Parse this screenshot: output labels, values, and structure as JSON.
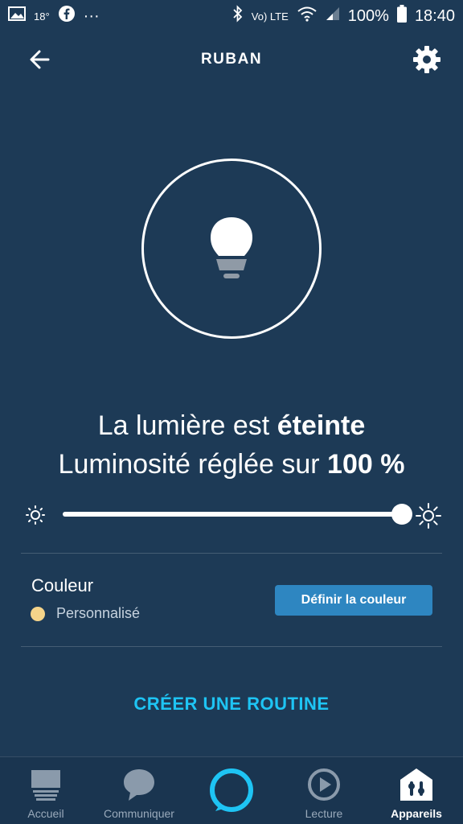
{
  "status_bar": {
    "temperature": "18°",
    "more": "···",
    "network": "Vo) LTE",
    "battery": "100%",
    "time": "18:40"
  },
  "header": {
    "title": "RUBAN"
  },
  "light": {
    "status_prefix": "La lumière est ",
    "status_value": "éteinte",
    "brightness_prefix": "Luminosité réglée sur ",
    "brightness_value": "100 %",
    "brightness_level": 1.0
  },
  "color": {
    "title": "Couleur",
    "value": "Personnalisé",
    "swatch": "#f5d48a",
    "button_label": "Définir la couleur"
  },
  "routine": {
    "label": "CRÉER UNE ROUTINE"
  },
  "nav": {
    "home": "Accueil",
    "communicate": "Communiquer",
    "play": "Lecture",
    "devices": "Appareils"
  },
  "colors": {
    "background": "#1d3a56",
    "accent": "#1ec4f4",
    "button": "#2e86c1"
  }
}
